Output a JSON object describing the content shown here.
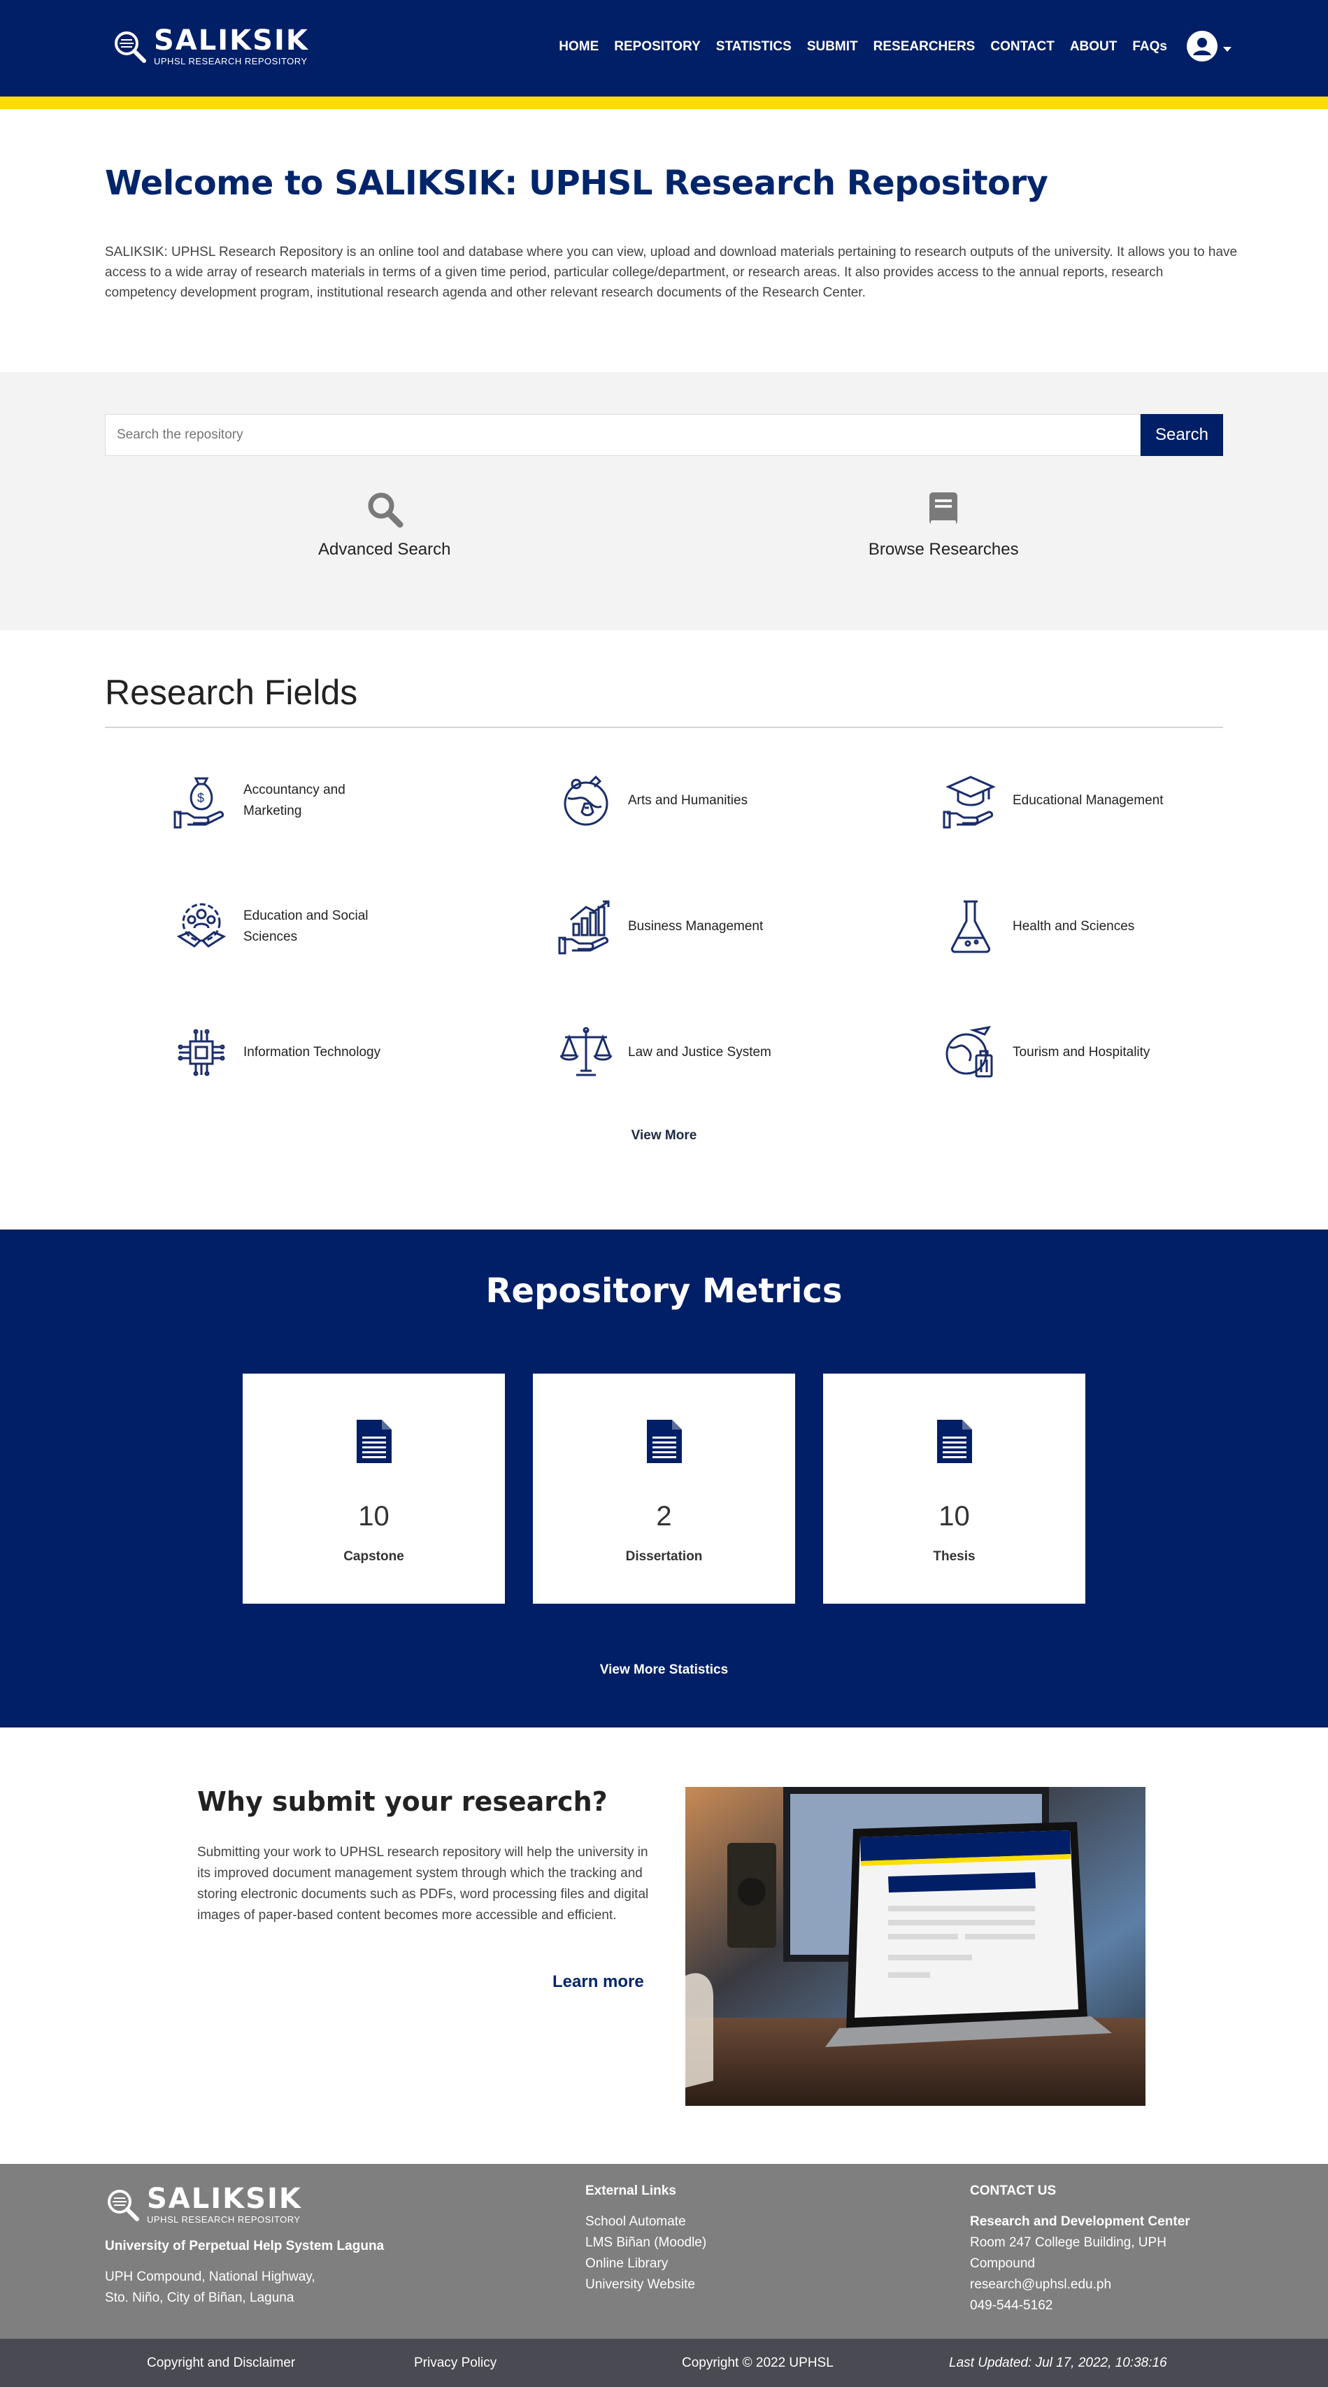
{
  "header": {
    "logo_title": "SALIKSIK",
    "logo_subtitle": "UPHSL RESEARCH REPOSITORY",
    "nav": [
      "HOME",
      "REPOSITORY",
      "STATISTICS",
      "SUBMIT",
      "RESEARCHERS",
      "CONTACT",
      "ABOUT",
      "FAQs"
    ],
    "accent_color": "#011f66",
    "stripe_color": "#ffdd00"
  },
  "welcome": {
    "title": "Welcome to SALIKSIK: UPHSL Research Repository",
    "description": "SALIKSIK: UPHSL Research Repository is an online tool and database where you can view, upload and download materials pertaining to research outputs of the university. It allows you to have access to a wide array of research materials in terms of a given time period, particular college/department, or research areas. It also provides access to the annual reports, research competency development program, institutional research agenda and other relevant research documents of the Research Center."
  },
  "search": {
    "placeholder": "Search the repository",
    "button": "Search",
    "advanced": "Advanced Search",
    "browse": "Browse Researches"
  },
  "fields": {
    "title": "Research Fields",
    "items": [
      {
        "label": "Accountancy and Marketing",
        "icon": "money-bag-hand-icon"
      },
      {
        "label": "Arts and Humanities",
        "icon": "globe-arts-icon"
      },
      {
        "label": "Educational Management",
        "icon": "graduation-cap-hand-icon"
      },
      {
        "label": "Education and Social Sciences",
        "icon": "people-handshake-icon"
      },
      {
        "label": "Business Management",
        "icon": "growth-chart-hand-icon"
      },
      {
        "label": "Health and Sciences",
        "icon": "flask-icon"
      },
      {
        "label": "Information Technology",
        "icon": "circuit-chip-icon"
      },
      {
        "label": "Law and Justice System",
        "icon": "scales-icon"
      },
      {
        "label": "Tourism and Hospitality",
        "icon": "globe-luggage-icon"
      }
    ],
    "view_more": "View More"
  },
  "metrics": {
    "title": "Repository Metrics",
    "cards": [
      {
        "count": "10",
        "label": "Capstone"
      },
      {
        "count": "2",
        "label": "Dissertation"
      },
      {
        "count": "10",
        "label": "Thesis"
      }
    ],
    "view_more": "View More Statistics"
  },
  "why": {
    "title": "Why submit your research?",
    "body": "Submitting your work to UPHSL research repository will help the university in its improved document management system through which the tracking and storing electronic documents such as PDFs, word processing files and digital images of paper-based content becomes more accessible and efficient.",
    "learn_more": "Learn more"
  },
  "footer": {
    "logo_title": "SALIKSIK",
    "logo_subtitle": "UPHSL RESEARCH REPOSITORY",
    "university": "University of Perpetual Help System Laguna",
    "address_line1": "UPH Compound, National Highway,",
    "address_line2": "Sto. Niño, City of Biñan, Laguna",
    "external_title": "External Links",
    "external_links": [
      "School Automate",
      "LMS Biñan (Moodle)",
      "Online Library",
      "University Website"
    ],
    "contact_title": "CONTACT US",
    "contact_org": "Research and Development Center",
    "contact_room": "Room 247 College Building, UPH Compound",
    "contact_email": "research@uphsl.edu.ph",
    "contact_phone": "049-544-5162"
  },
  "bottom_bar": {
    "copyright_disclaimer": "Copyright and Disclaimer",
    "privacy": "Privacy Policy",
    "copyright": "Copyright © 2022 UPHSL",
    "last_updated": "Last Updated: Jul 17, 2022, 10:38:16"
  }
}
